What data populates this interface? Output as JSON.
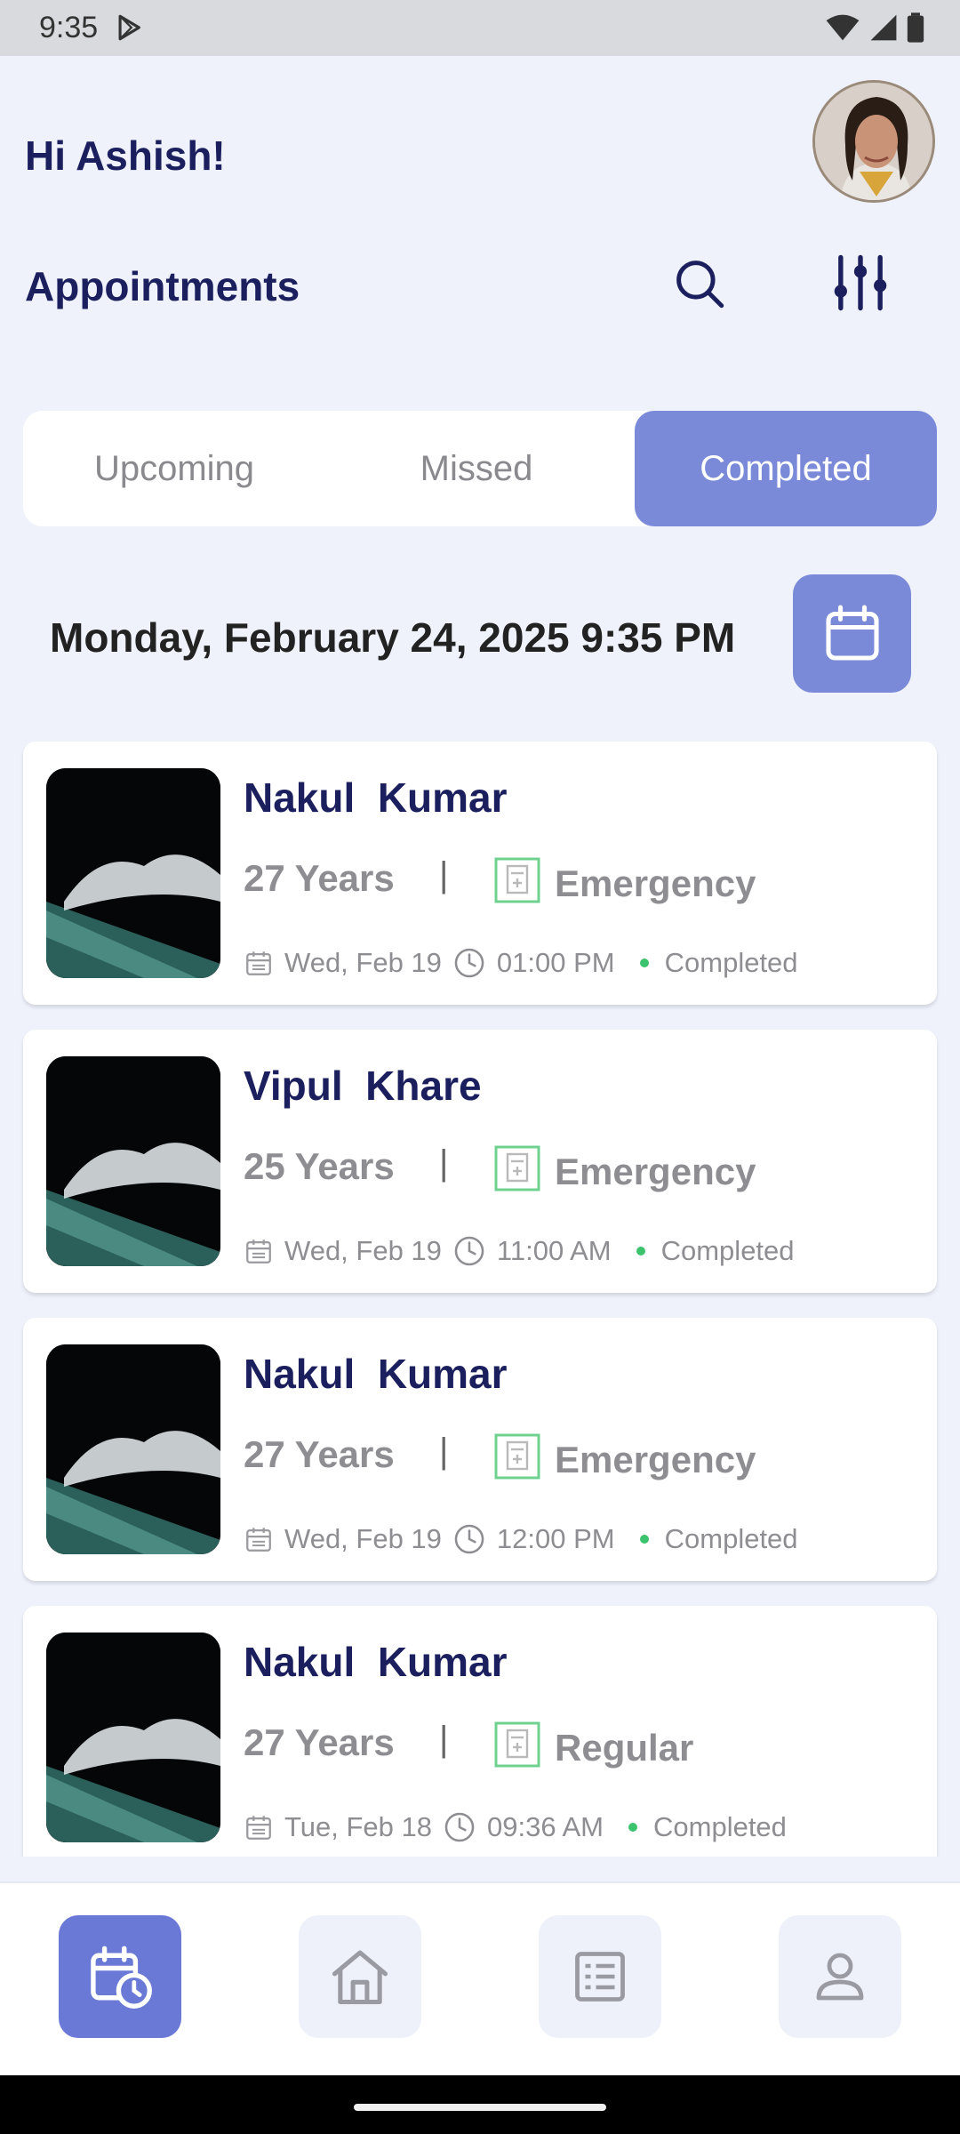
{
  "status_bar": {
    "time": "9:35"
  },
  "header": {
    "greeting": "Hi Ashish!",
    "section_title": "Appointments"
  },
  "tabs": [
    {
      "label": "Upcoming",
      "active": false
    },
    {
      "label": "Missed",
      "active": false
    },
    {
      "label": "Completed",
      "active": true
    }
  ],
  "current_datetime": "Monday, February 24, 2025 9:35 PM",
  "appointments": [
    {
      "name": "Nakul  Kumar",
      "age": "27 Years",
      "separator": "|",
      "type": "Emergency",
      "date": "Wed, Feb 19",
      "time": "01:00 PM",
      "status": "Completed"
    },
    {
      "name": "Vipul  Khare",
      "age": "25 Years",
      "separator": "|",
      "type": "Emergency",
      "date": "Wed, Feb 19",
      "time": "11:00 AM",
      "status": "Completed"
    },
    {
      "name": "Nakul  Kumar",
      "age": "27 Years",
      "separator": "|",
      "type": "Emergency",
      "date": "Wed, Feb 19",
      "time": "12:00 PM",
      "status": "Completed"
    },
    {
      "name": "Nakul  Kumar",
      "age": "27 Years",
      "separator": "|",
      "type": "Regular",
      "date": "Tue, Feb 18",
      "time": "09:36 AM",
      "status": "Completed"
    }
  ],
  "bottom_nav": [
    {
      "icon": "calendar-clock-icon",
      "active": true
    },
    {
      "icon": "home-icon",
      "active": false
    },
    {
      "icon": "list-icon",
      "active": false
    },
    {
      "icon": "profile-icon",
      "active": false
    }
  ],
  "colors": {
    "accent": "#7a8ad9",
    "nav_active": "#6a78d6",
    "title": "#1b1f5e",
    "status_dot": "#3cc36d",
    "background": "#eff2fb"
  }
}
